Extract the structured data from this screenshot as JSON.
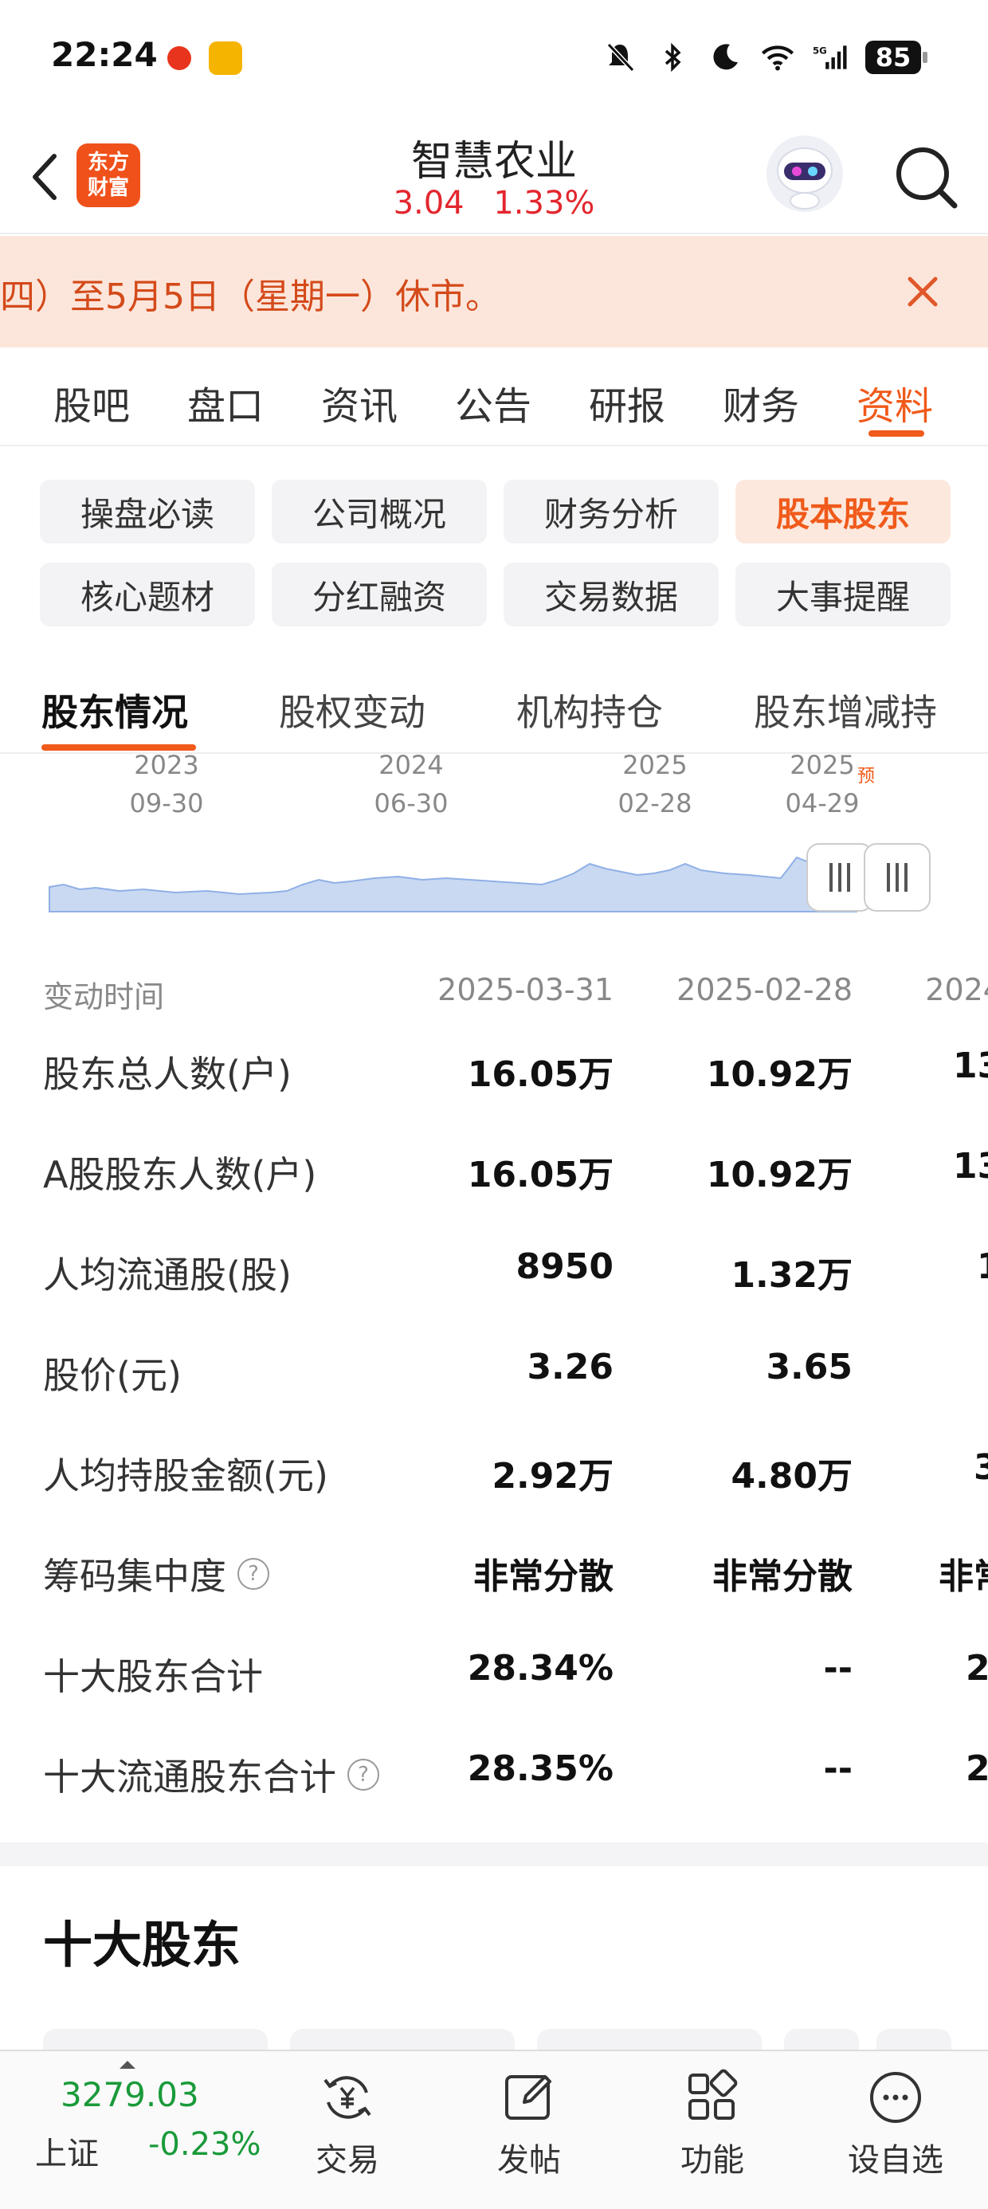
{
  "status_bar": {
    "time": "22:24",
    "battery": "85"
  },
  "header": {
    "logo_text": [
      "东方",
      "财富"
    ],
    "stock_name": "智慧农业",
    "price": "3.04",
    "change": "1.33%"
  },
  "notice": {
    "text": "四）至5月5日（星期一）休市。"
  },
  "main_tabs": [
    "股吧",
    "盘口",
    "资讯",
    "公告",
    "研报",
    "财务",
    "资料"
  ],
  "main_tab_active": 6,
  "chips": [
    "操盘必读",
    "公司概况",
    "财务分析",
    "股本股东",
    "核心题材",
    "分红融资",
    "交易数据",
    "大事提醒"
  ],
  "chip_active": 3,
  "sub_tabs": [
    "股东情况",
    "股权变动",
    "机构持仓",
    "股东增减持"
  ],
  "sub_tab_active": 0,
  "chart": {
    "x_labels": [
      {
        "year": "2023",
        "date": "09-30"
      },
      {
        "year": "2024",
        "date": "06-30"
      },
      {
        "year": "2025",
        "date": "02-28"
      },
      {
        "year": "2025",
        "date": "04-29"
      }
    ],
    "predict_tag": "预",
    "series_color": "#c9d9f2",
    "line_color": "#8fb0e6"
  },
  "table": {
    "header_label": "变动时间",
    "columns": [
      "2025-03-31",
      "2025-02-28",
      "2024"
    ],
    "rows": [
      {
        "label": "股东总人数(户)",
        "values": [
          "16.05万",
          "10.92万",
          "13"
        ],
        "help": false
      },
      {
        "label": "A股股东人数(户)",
        "values": [
          "16.05万",
          "10.92万",
          "13"
        ],
        "help": false
      },
      {
        "label": "人均流通股(股)",
        "values": [
          "8950",
          "1.32万",
          "1"
        ],
        "help": false
      },
      {
        "label": "股价(元)",
        "values": [
          "3.26",
          "3.65",
          ""
        ],
        "help": false
      },
      {
        "label": "人均持股金额(元)",
        "values": [
          "2.92万",
          "4.80万",
          "3"
        ],
        "help": false
      },
      {
        "label": "筹码集中度",
        "values": [
          "非常分散",
          "非常分散",
          "非常"
        ],
        "help": true
      },
      {
        "label": "十大股东合计",
        "values": [
          "28.34%",
          "--",
          "2"
        ],
        "help": false
      },
      {
        "label": "十大流通股东合计",
        "values": [
          "28.35%",
          "--",
          "2"
        ],
        "help": true
      }
    ]
  },
  "help_glyph": "?",
  "section_title": "十大股东",
  "bottom_bar": {
    "index_value": "3279.03",
    "index_name": "上证",
    "index_change": "-0.23%",
    "items": [
      "交易",
      "发帖",
      "功能",
      "设自选"
    ]
  },
  "colors": {
    "accent": "#f05a1a",
    "up": "#e3262e",
    "down": "#1a9a3a"
  }
}
